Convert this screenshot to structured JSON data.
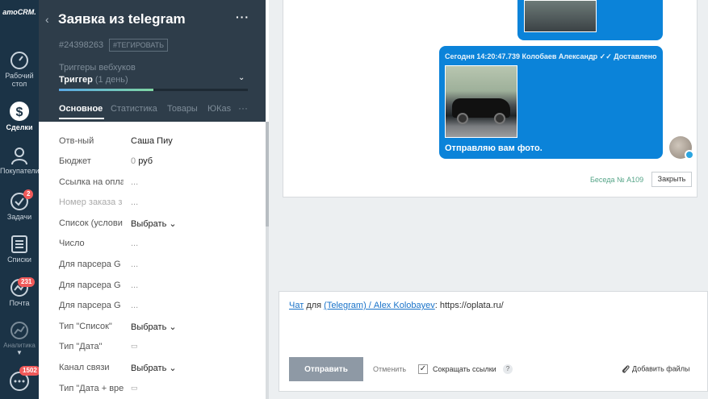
{
  "nav": {
    "logo": "amoCRM.",
    "items": [
      {
        "label": "Рабочий стол",
        "label2": "стол"
      },
      {
        "label": "Сделки"
      },
      {
        "label": "Покупатели"
      },
      {
        "label": "Задачи",
        "badge": "2"
      },
      {
        "label": "Списки"
      },
      {
        "label": "Почта",
        "badge": "231"
      },
      {
        "label": "Аналитика"
      },
      {
        "label": "",
        "badge": "1502"
      }
    ]
  },
  "lead": {
    "title": "Заявка из telegram",
    "id": "#24398263",
    "tag": "#ТЕГИРОВАТЬ",
    "pipeline": "Триггеры вебхуков",
    "stage": "Триггер",
    "stage_duration": "(1 день)",
    "tabs": [
      "Основное",
      "Статистика",
      "Товары",
      "ЮКas"
    ],
    "fields": [
      {
        "label": "Отв-ный",
        "value": "Саша Пиу"
      },
      {
        "label": "Бюджет",
        "value": "0",
        "unit": "руб"
      },
      {
        "label": "Ссылка на опла",
        "value": "..."
      },
      {
        "label": "Номер заказа з",
        "value": "..."
      },
      {
        "label": "Список (услови",
        "value": "Выбрать"
      },
      {
        "label": "Число",
        "value": "..."
      },
      {
        "label": "Для парсера G",
        "value": "..."
      },
      {
        "label": "Для парсера G",
        "value": "..."
      },
      {
        "label": "Для парсера G",
        "value": "..."
      },
      {
        "label": "Тип \"Список\"",
        "value": "Выбрать"
      },
      {
        "label": "Тип \"Дата\"",
        "value": "▭"
      },
      {
        "label": "Канал связи",
        "value": "Выбрать"
      },
      {
        "label": "Тип \"Дата + вре",
        "value": "▭"
      }
    ]
  },
  "feed": {
    "message": {
      "meta": "Сегодня 14:20:47.739 Колобаев Александр ✓✓ Доставлено",
      "text": "Отправляю вам фото."
    },
    "conversation": "Беседа № А109",
    "close_label": "Закрыть"
  },
  "composer": {
    "chat_link": "Чат",
    "for_word": "для",
    "recipient": "(Telegram) / Alex Kolobayev",
    "text": ": https://oplata.ru/",
    "send_label": "Отправить",
    "cancel_label": "Отменить",
    "shorten_label": "Сокращать ссылки",
    "shorten_checked": true,
    "help": "?",
    "attach_label": "Добавить файлы"
  },
  "colors": {
    "nav_bg": "#1b3346",
    "lead_header_bg": "#2e3d4a",
    "message_bg": "#0b83d9",
    "badge": "#f05a5a",
    "link": "#1a73c9"
  }
}
